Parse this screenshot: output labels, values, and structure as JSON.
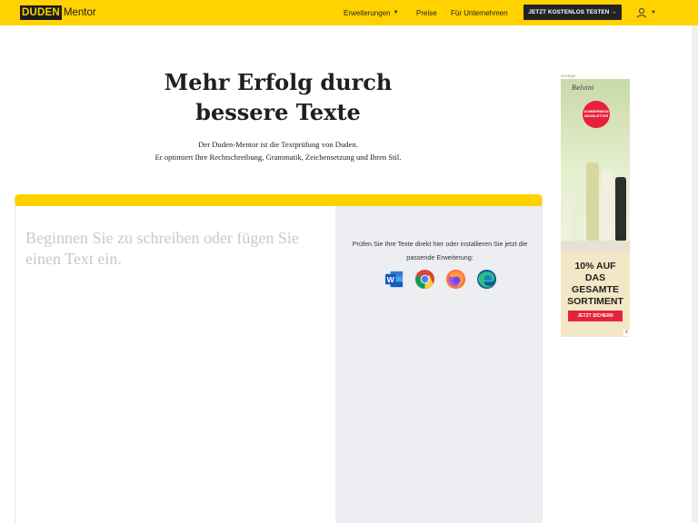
{
  "header": {
    "logo_duden": "DUDEN",
    "logo_mentor": "Mentor",
    "nav": {
      "erweiterungen": "Erweiterungen",
      "preise": "Preise",
      "unternehmen": "Für Unternehmen"
    },
    "cta_label": "JETZT KOSTENLOS TESTEN →",
    "icons": {
      "menu_caret": "caret-down-icon",
      "user": "user-icon"
    }
  },
  "hero": {
    "title_line1": "Mehr Erfolg durch",
    "title_line2": "bessere Texte",
    "subtitle_line1": "Der Duden-Mentor ist die Textprüfung von Duden.",
    "subtitle_line2": "Er optimiert Ihre Rechtschreibung, Grammatik, Zeichensetzung und Ihren Stil."
  },
  "editor": {
    "placeholder": "Beginnen Sie zu schreiben oder fügen Sie einen Text ein."
  },
  "sidebar": {
    "install_text": "Prüfen Sie Ihre Texte direkt hier oder installieren Sie jetzt die passende Erweiterung:",
    "extensions": [
      "word-icon",
      "chrome-icon",
      "firefox-icon",
      "edge-icon"
    ]
  },
  "ad": {
    "label": "Anzeige",
    "brand": "Belvini",
    "badge": "SOMMERWEIN NEWSLETTER",
    "offer_line1": "10% AUF",
    "offer_line2": "DAS GESAMTE",
    "offer_line3": "SORTIMENT",
    "button": "JETZT SICHERN",
    "close": "x"
  },
  "colors": {
    "brand_yellow": "#ffd200",
    "dark": "#232323",
    "side_panel": "#eceef1",
    "placeholder": "#c9c9c9",
    "ad_red": "#e8213b"
  }
}
